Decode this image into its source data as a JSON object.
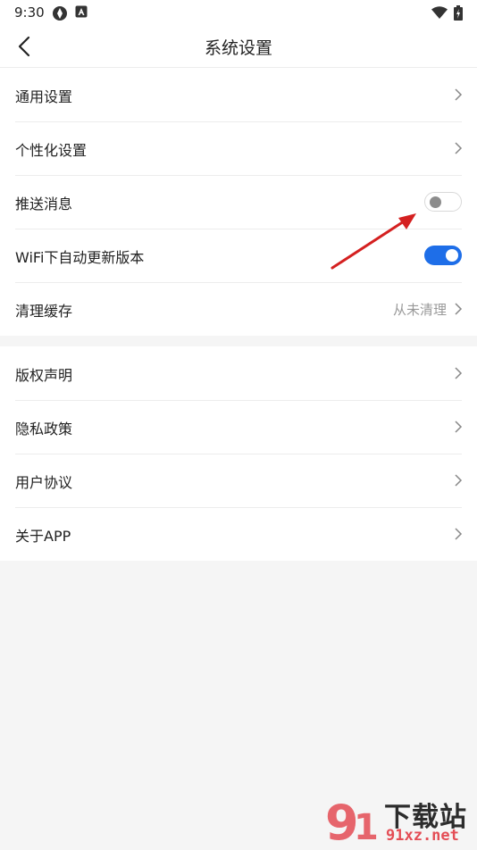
{
  "status_bar": {
    "time": "9:30"
  },
  "header": {
    "title": "系统设置"
  },
  "settings_group_1": [
    {
      "label": "通用设置"
    },
    {
      "label": "个性化设置"
    },
    {
      "label": "推送消息",
      "toggle": "off"
    },
    {
      "label": "WiFi下自动更新版本",
      "toggle": "on"
    },
    {
      "label": "清理缓存",
      "value": "从未清理"
    }
  ],
  "settings_group_2": [
    {
      "label": "版权声明"
    },
    {
      "label": "隐私政策"
    },
    {
      "label": "用户协议"
    },
    {
      "label": "关于APP"
    }
  ],
  "watermark": {
    "text": "下载站",
    "domain": "91xz.net"
  },
  "colors": {
    "accent": "#1e6ee8",
    "annotation_arrow": "#d42020",
    "background": "#f5f5f5"
  }
}
